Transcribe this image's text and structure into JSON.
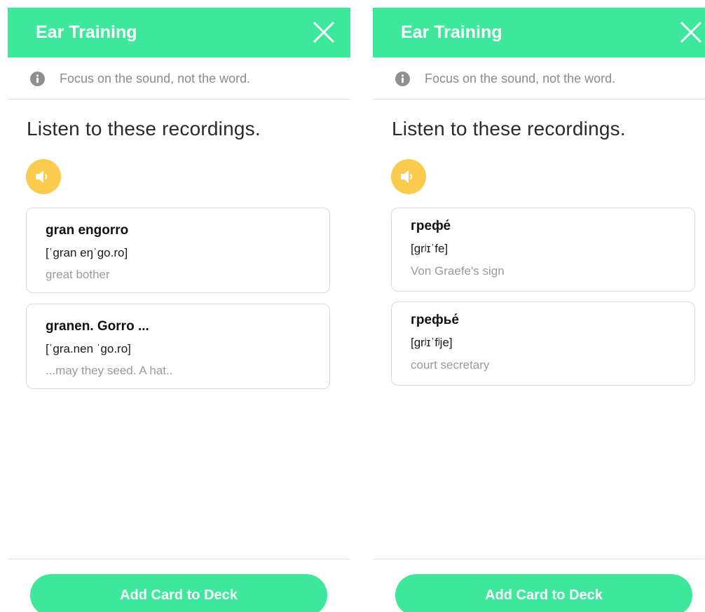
{
  "colors": {
    "header_green": "#3ee89a",
    "speaker_yellow": "#fbcb4e",
    "muted_text": "#8b8b8b"
  },
  "panels": [
    {
      "header_title": "Ear Training",
      "close_icon": "close-icon",
      "tip": {
        "icon": "info-icon",
        "text": "Focus on the sound, not the word."
      },
      "prompt": "Listen to these recordings.",
      "speaker_icon": "speaker-icon",
      "cards": [
        {
          "word": "gran engorro",
          "ipa": "[ˈgran eŋˈgo.ro]",
          "meaning": "great bother"
        },
        {
          "word": "granen. Gorro ...",
          "ipa": "[ˈgra.nen ˈgo.ro]",
          "meaning": "...may they seed. A hat.."
        }
      ],
      "add_button": "Add Card to Deck"
    },
    {
      "header_title": "Ear Training",
      "close_icon": "close-icon",
      "tip": {
        "icon": "info-icon",
        "text": "Focus on the sound, not the word."
      },
      "prompt": "Listen to these recordings.",
      "speaker_icon": "speaker-icon",
      "cards": [
        {
          "word": "грефе́",
          "ipa": "[grʲɪˈfe]",
          "meaning": "Von Graefe's sign"
        },
        {
          "word": "грефье́",
          "ipa": "[grʲɪˈfʲje]",
          "meaning": "court secretary"
        }
      ],
      "add_button": "Add Card to Deck"
    }
  ]
}
